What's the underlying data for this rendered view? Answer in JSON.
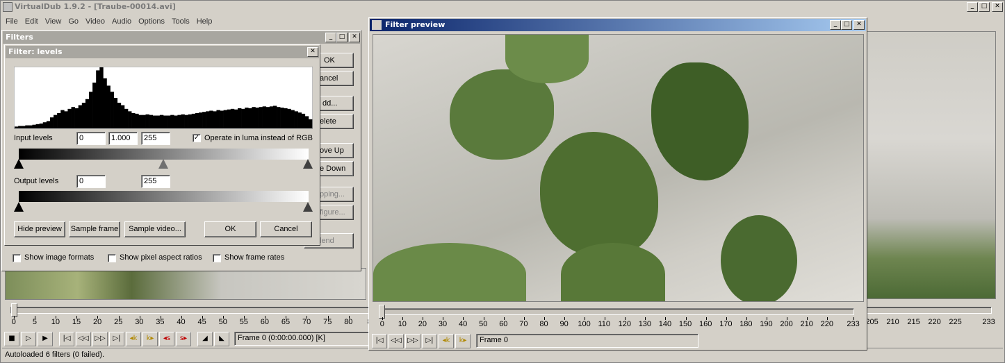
{
  "main_window": {
    "title": "VirtualDub 1.9.2 - [Traube-00014.avi]"
  },
  "menu": [
    "File",
    "Edit",
    "View",
    "Go",
    "Video",
    "Audio",
    "Options",
    "Tools",
    "Help"
  ],
  "filters_dialog": {
    "title": "Filters",
    "buttons": [
      "OK",
      "ancel",
      "dd...",
      "elete",
      "ove Up",
      "e Down",
      "pping...",
      "figure...",
      "lend"
    ],
    "checkboxes": [
      {
        "label": "Show image formats",
        "checked": false
      },
      {
        "label": "Show pixel aspect ratios",
        "checked": false
      },
      {
        "label": "Show frame rates",
        "checked": false
      }
    ]
  },
  "levels_dialog": {
    "title": "Filter: levels",
    "input_label": "Input levels",
    "input_black": "0",
    "input_gamma": "1.000",
    "input_white": "255",
    "luma_label": "Operate in luma instead of RGB",
    "luma_checked": true,
    "output_label": "Output levels",
    "output_black": "0",
    "output_white": "255",
    "buttons": {
      "hide_preview": "Hide preview",
      "sample_frame": "Sample frame",
      "sample_video": "Sample video...",
      "ok": "OK",
      "cancel": "Cancel"
    },
    "histogram_levels": [
      0.03,
      0.04,
      0.04,
      0.05,
      0.05,
      0.06,
      0.07,
      0.08,
      0.1,
      0.12,
      0.18,
      0.22,
      0.25,
      0.3,
      0.28,
      0.32,
      0.35,
      0.33,
      0.38,
      0.42,
      0.48,
      0.6,
      0.75,
      0.95,
      1.0,
      0.82,
      0.7,
      0.6,
      0.5,
      0.42,
      0.38,
      0.32,
      0.28,
      0.25,
      0.24,
      0.22,
      0.22,
      0.23,
      0.22,
      0.21,
      0.21,
      0.22,
      0.21,
      0.21,
      0.22,
      0.21,
      0.22,
      0.23,
      0.22,
      0.23,
      0.24,
      0.25,
      0.26,
      0.27,
      0.28,
      0.29,
      0.28,
      0.3,
      0.29,
      0.3,
      0.31,
      0.32,
      0.31,
      0.33,
      0.32,
      0.34,
      0.33,
      0.35,
      0.34,
      0.35,
      0.36,
      0.35,
      0.36,
      0.37,
      0.35,
      0.34,
      0.33,
      0.32,
      0.3,
      0.28,
      0.26,
      0.24,
      0.2,
      0.15
    ]
  },
  "preview_window": {
    "title": "Filter preview",
    "frame_text": "Frame 0",
    "ticks": [
      "0",
      "10",
      "20",
      "30",
      "40",
      "50",
      "60",
      "70",
      "80",
      "90",
      "100",
      "110",
      "120",
      "130",
      "140",
      "150",
      "160",
      "170",
      "180",
      "190",
      "200",
      "210",
      "220",
      "233"
    ]
  },
  "main_timeline": {
    "ticks_left": [
      "0",
      "5",
      "10",
      "15",
      "20",
      "25",
      "30",
      "35",
      "40",
      "45",
      "50",
      "55",
      "60",
      "65",
      "70",
      "75",
      "80",
      "8"
    ],
    "ticks_right": [
      "205",
      "210",
      "215",
      "220",
      "225",
      "233"
    ],
    "frame_text": "Frame 0 (0:00:00.000) [K]"
  },
  "status_bar": {
    "text": "Autoloaded 6 filters (0 failed)."
  }
}
